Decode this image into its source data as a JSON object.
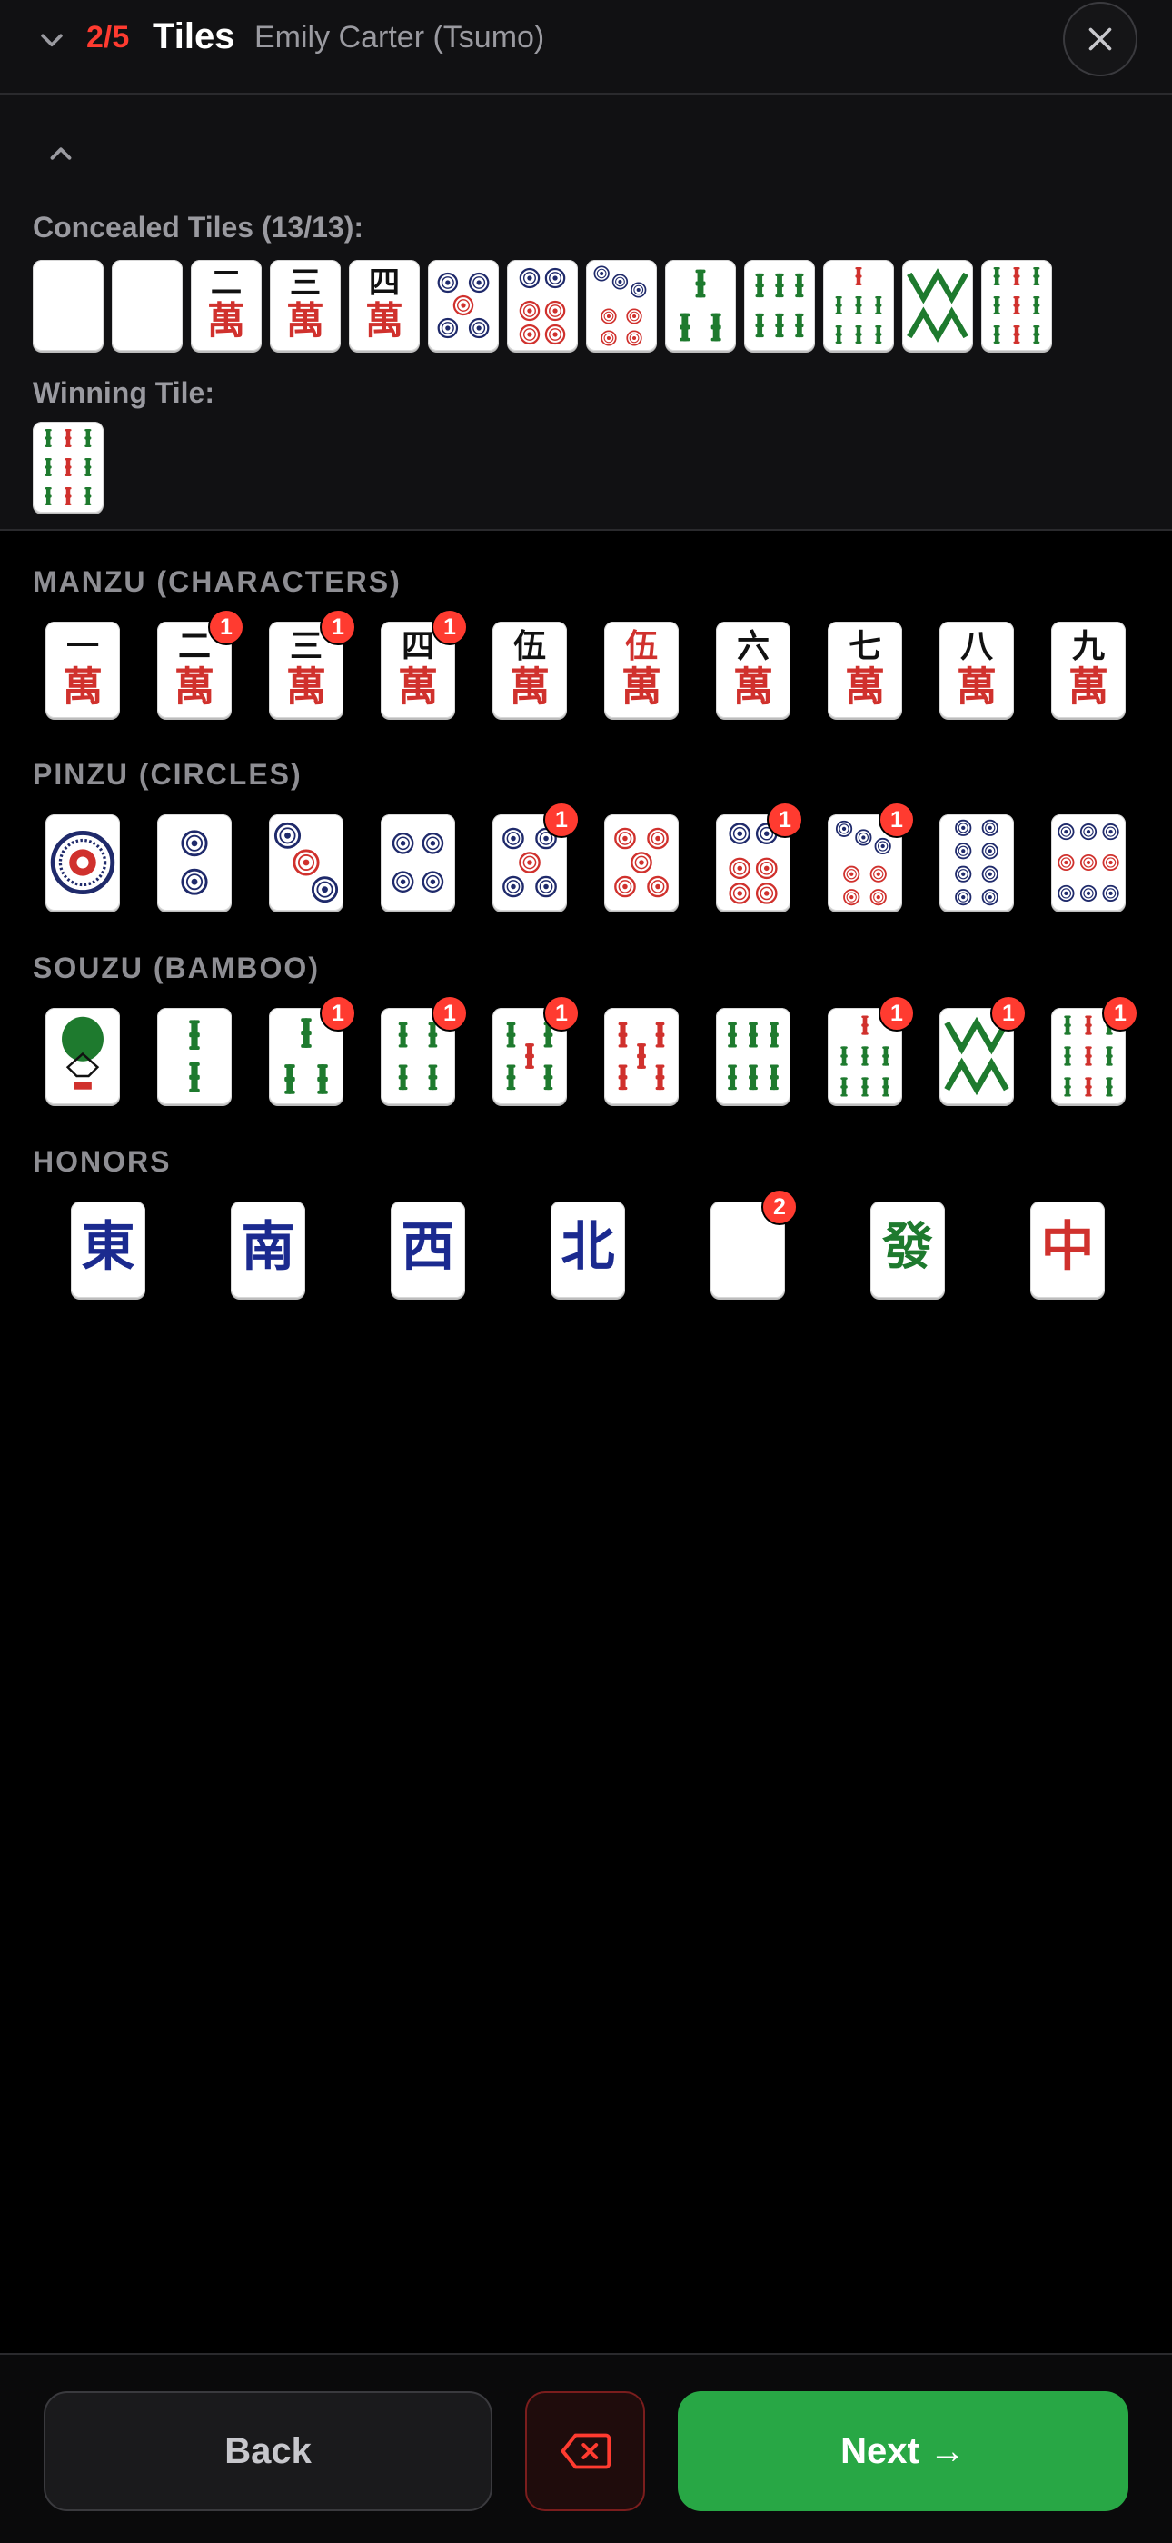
{
  "header": {
    "step": "2/5",
    "title": "Tiles",
    "subtitle": "Emily Carter (Tsumo)",
    "close_icon": "close-icon"
  },
  "hand": {
    "concealed_label": "Concealed Tiles (13/13):",
    "winning_label": "Winning Tile:",
    "concealed": [
      "blank",
      "blank",
      "m2",
      "m3",
      "m4",
      "p5",
      "p6",
      "p7",
      "s3",
      "s6",
      "s7",
      "s8",
      "s9"
    ],
    "winning": "s9r"
  },
  "sections": [
    {
      "label": "MANZU (CHARACTERS)",
      "tiles": [
        {
          "id": "m1",
          "count": null
        },
        {
          "id": "m2",
          "count": "1"
        },
        {
          "id": "m3",
          "count": "1"
        },
        {
          "id": "m4",
          "count": "1"
        },
        {
          "id": "m5",
          "count": null
        },
        {
          "id": "m5r",
          "count": null
        },
        {
          "id": "m6",
          "count": null
        },
        {
          "id": "m7",
          "count": null
        },
        {
          "id": "m8",
          "count": null
        },
        {
          "id": "m9",
          "count": null
        }
      ]
    },
    {
      "label": "PINZU (CIRCLES)",
      "tiles": [
        {
          "id": "p1",
          "count": null
        },
        {
          "id": "p2",
          "count": null
        },
        {
          "id": "p3",
          "count": null
        },
        {
          "id": "p4",
          "count": null
        },
        {
          "id": "p5",
          "count": "1"
        },
        {
          "id": "p5r",
          "count": null
        },
        {
          "id": "p6",
          "count": "1"
        },
        {
          "id": "p7",
          "count": "1"
        },
        {
          "id": "p8",
          "count": null
        },
        {
          "id": "p9",
          "count": null
        }
      ]
    },
    {
      "label": "SOUZU (BAMBOO)",
      "tiles": [
        {
          "id": "s1",
          "count": null
        },
        {
          "id": "s2",
          "count": null
        },
        {
          "id": "s3",
          "count": "1"
        },
        {
          "id": "s4",
          "count": "1"
        },
        {
          "id": "s5",
          "count": "1"
        },
        {
          "id": "s5r",
          "count": null
        },
        {
          "id": "s6",
          "count": null
        },
        {
          "id": "s7",
          "count": "1"
        },
        {
          "id": "s8",
          "count": "1"
        },
        {
          "id": "s9",
          "count": "1"
        }
      ]
    },
    {
      "label": "HONORS",
      "tiles": [
        {
          "id": "east",
          "count": null
        },
        {
          "id": "south",
          "count": null
        },
        {
          "id": "west",
          "count": null
        },
        {
          "id": "north",
          "count": null
        },
        {
          "id": "white",
          "count": "2"
        },
        {
          "id": "green",
          "count": null
        },
        {
          "id": "red",
          "count": null
        }
      ]
    }
  ],
  "glyphs": {
    "m1": "一",
    "m2": "二",
    "m3": "三",
    "m4": "四",
    "m5": "伍",
    "m5r": "伍",
    "m6": "六",
    "m7": "七",
    "m8": "八",
    "m9": "九",
    "east": "東",
    "south": "南",
    "west": "西",
    "north": "北",
    "green": "發",
    "red": "中",
    "wan": "萬"
  },
  "footer": {
    "back_label": "Back",
    "next_label": "Next →",
    "delete_icon": "backspace-icon"
  },
  "colors": {
    "accent_red": "#ff3b30",
    "next_green": "#28a745",
    "tile_red": "#d0312d",
    "tile_blue": "#1b2a8f",
    "tile_green": "#1e7a2e",
    "dot_navy": "#1f2a6b"
  }
}
